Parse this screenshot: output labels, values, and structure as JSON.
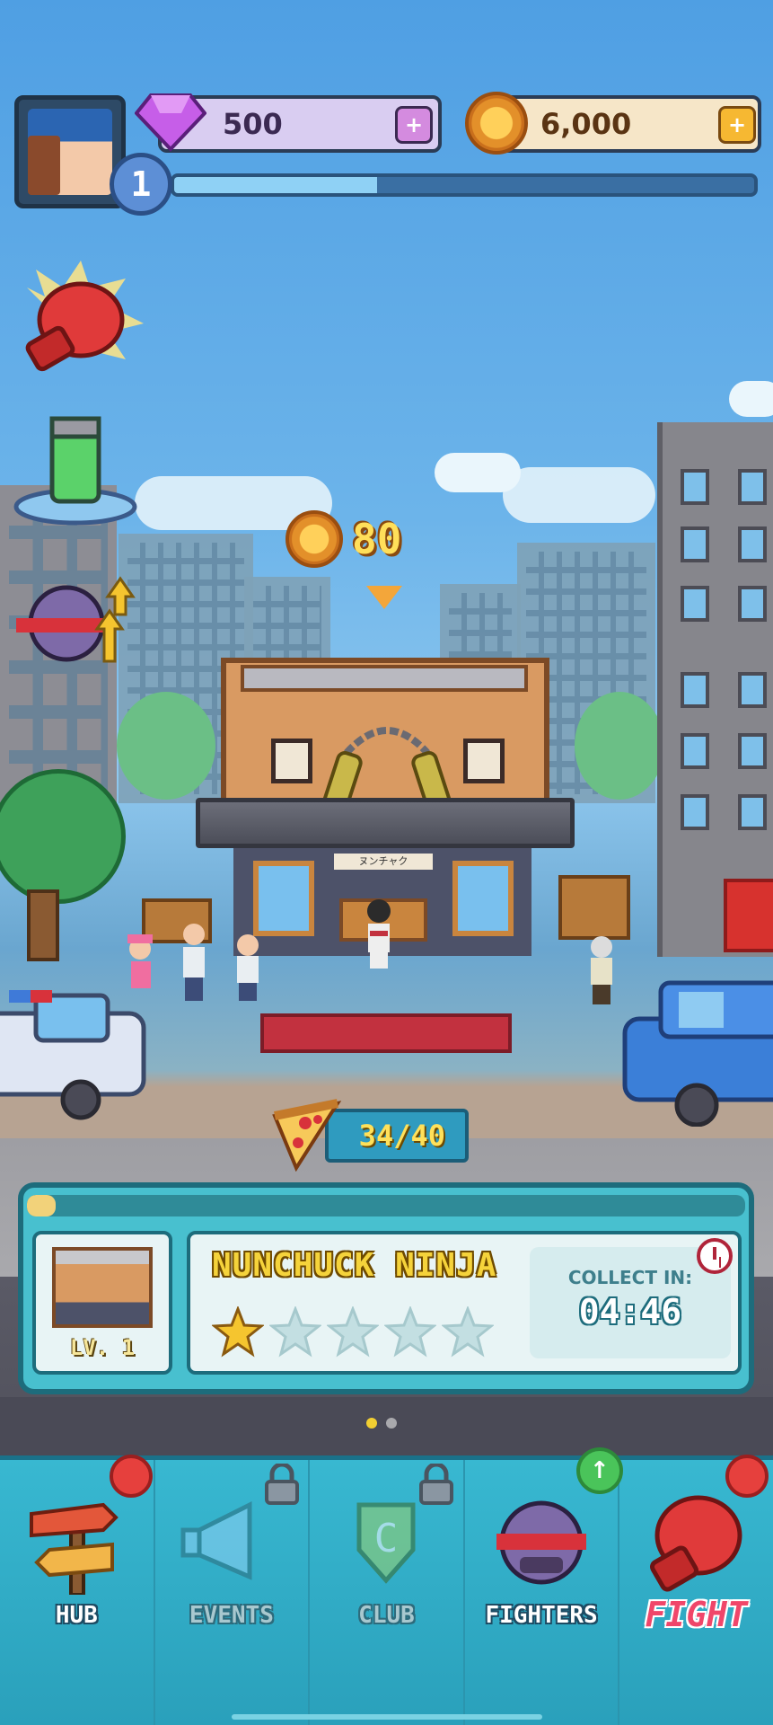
{
  "hud": {
    "player_level": "1",
    "xp_progress": 0.35,
    "gems": "500",
    "coins": "6,000",
    "gem_plus": "+",
    "coin_plus": "+"
  },
  "reward": {
    "coins": "80"
  },
  "building": {
    "sign_text": "ヌンチャク"
  },
  "energy": {
    "value": "34/40"
  },
  "card": {
    "progress": 0.04,
    "level_label": "LV. 1",
    "name": "NUNCHUCK NINJA",
    "stars_filled": 1,
    "stars_total": 5,
    "collect_label": "COLLECT IN:",
    "collect_time": "04:46"
  },
  "pagination": {
    "pages": 2,
    "active": 0
  },
  "nav": {
    "hub": "HUB",
    "events": "EVENTS",
    "club": "CLUB",
    "fighters": "FIGHTERS",
    "fight": "FIGHT"
  },
  "colors": {
    "sky": "#58a8e6",
    "accent_gold": "#f5d33b",
    "nav_teal": "#38b8d1",
    "fight_pink": "#f0466a"
  },
  "icons": [
    "gem-icon",
    "coin-icon",
    "boxing-glove-icon",
    "energy-canister-icon",
    "fighter-upgrade-icon",
    "pizza-icon",
    "star-icon",
    "clock-icon",
    "signpost-icon",
    "megaphone-icon",
    "club-shield-icon",
    "fighter-head-icon",
    "lock-icon"
  ]
}
